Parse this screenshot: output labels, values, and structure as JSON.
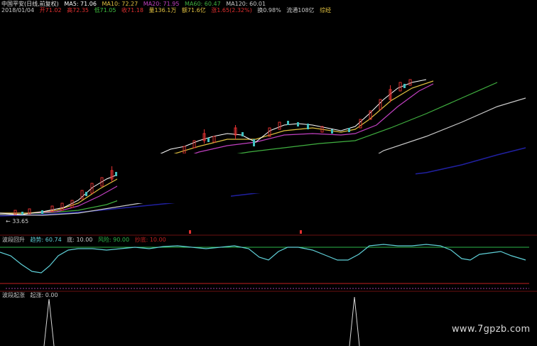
{
  "header_row1": {
    "title": "中国平安(日线,前复权)",
    "ma5": "MA5: 71.06",
    "ma10": "MA10: 72.27",
    "ma20": "MA20: 71.95",
    "ma60": "MA60: 60.47",
    "ma120": "MA120: 60.01"
  },
  "header_row2": {
    "date": "2018/01/04",
    "open": "开71.02",
    "high": "高72.35",
    "low": "低71.05",
    "close": "收71.18",
    "volume": "量136.1万",
    "amount": "额71.6亿",
    "change": "涨1.65(2.32%)",
    "turnover": "换0.98%",
    "circulation": "流通108亿",
    "extra": "综经"
  },
  "price_low_label": "33.65",
  "panel2": {
    "name": "波段回升",
    "trend_label": "趋势: 60.74",
    "low_label": "底: 10.00",
    "risk_label": "风险: 90.00",
    "bottom_label": "抄底: 10.00"
  },
  "panel3": {
    "name": "波段起涨",
    "signal_label": "起涨: 0.00"
  },
  "watermark": "www.7gpzb.com",
  "colors": {
    "background": "#000000",
    "ma5": "#ffffff",
    "ma10": "#e0c040",
    "ma20": "#c040c0",
    "ma60": "#40b040",
    "ma120": "#c8c8c8",
    "long": "#2020a0",
    "trend": "#5fd0d8",
    "risk_line": "#2db84a",
    "bottom_line": "#c02020",
    "up_candle": "#e03030",
    "down_candle": "#40c0c0"
  }
}
